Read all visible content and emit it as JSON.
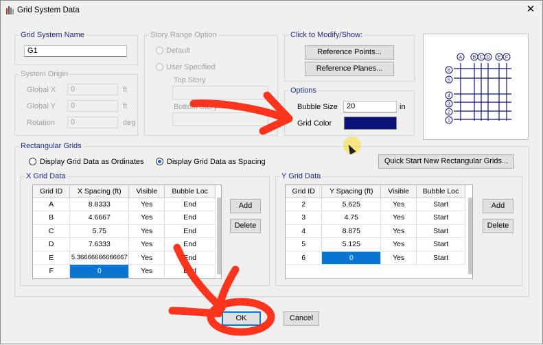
{
  "window": {
    "title": "Grid System Data",
    "close_label": "✕"
  },
  "grid_system_name": {
    "label": "Grid System Name",
    "value": "G1"
  },
  "story_range": {
    "label": "Story Range Option",
    "default_label": "Default",
    "user_label": "User Specified",
    "top_story_label": "Top Story",
    "bottom_story_label": "Bottom Story"
  },
  "origin": {
    "label": "System Origin",
    "rows": [
      {
        "label": "Global  X",
        "value": "0",
        "unit": "ft"
      },
      {
        "label": "Global  Y",
        "value": "0",
        "unit": "ft"
      },
      {
        "label": "Rotation",
        "value": "0",
        "unit": "deg"
      }
    ]
  },
  "modify": {
    "label": "Click to Modify/Show:",
    "ref_points": "Reference Points...",
    "ref_planes": "Reference Planes..."
  },
  "options": {
    "label": "Options",
    "bubble_size_label": "Bubble Size",
    "bubble_size_value": "20",
    "bubble_unit": "in",
    "grid_color_label": "Grid Color",
    "grid_color": "#0b1278"
  },
  "preview": {
    "x_bubbles": [
      "A",
      "B",
      "C",
      "D",
      "E",
      "F"
    ],
    "y_bubbles": [
      "6",
      "5",
      "4",
      "3",
      "2",
      "1"
    ]
  },
  "rect_grids": {
    "label": "Rectangular Grids",
    "ordinates_label": "Display Grid Data as Ordinates",
    "spacing_label": "Display Grid Data as Spacing",
    "quick_start": "Quick Start New Rectangular Grids..."
  },
  "x_grid": {
    "label": "X Grid Data",
    "columns": [
      "Grid ID",
      "X Spacing  (ft)",
      "Visible",
      "Bubble Loc"
    ],
    "rows": [
      [
        "A",
        "8.8333",
        "Yes",
        "End"
      ],
      [
        "B",
        "4.6667",
        "Yes",
        "End"
      ],
      [
        "C",
        "5.75",
        "Yes",
        "End"
      ],
      [
        "D",
        "7.6333",
        "Yes",
        "End"
      ],
      [
        "E",
        "5.36666666666667",
        "Yes",
        "End"
      ],
      [
        "F",
        "0",
        "Yes",
        "End"
      ]
    ],
    "add": "Add",
    "delete": "Delete"
  },
  "y_grid": {
    "label": "Y Grid Data",
    "columns": [
      "Grid ID",
      "Y Spacing  (ft)",
      "Visible",
      "Bubble Loc"
    ],
    "rows": [
      [
        "2",
        "5.625",
        "Yes",
        "Start"
      ],
      [
        "3",
        "4.75",
        "Yes",
        "Start"
      ],
      [
        "4",
        "8.875",
        "Yes",
        "Start"
      ],
      [
        "5",
        "5.125",
        "Yes",
        "Start"
      ],
      [
        "6",
        "0",
        "Yes",
        "Start"
      ]
    ],
    "add": "Add",
    "delete": "Delete"
  },
  "footer": {
    "ok": "OK",
    "cancel": "Cancel"
  }
}
